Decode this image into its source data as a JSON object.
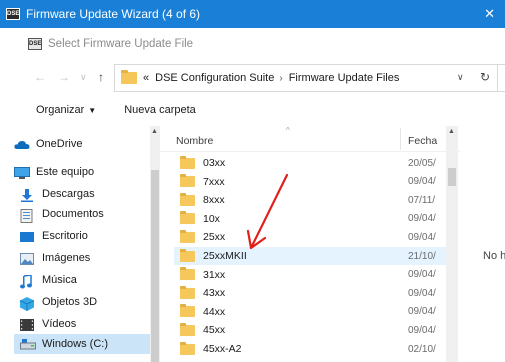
{
  "window": {
    "app_icon_text": "DSE",
    "title": "Firmware Update Wizard (4 of 6)",
    "close_glyph": "✕"
  },
  "dialog": {
    "app_icon_text": "DSE",
    "title": "Select Firmware Update File"
  },
  "address": {
    "back_glyph": "←",
    "forward_glyph": "→",
    "recent_glyph": "∨",
    "up_glyph": "↑",
    "overflow": "«",
    "crumbs": [
      "DSE Configuration Suite",
      "Firmware Update Files"
    ],
    "separator": "›",
    "dropdown_glyph": "∨",
    "refresh_glyph": "↻"
  },
  "toolbar": {
    "organize_label": "Organizar",
    "organize_caret": "▼",
    "new_folder_label": "Nueva carpeta"
  },
  "nav": {
    "items": [
      {
        "label": "OneDrive",
        "icon": "cloud-icon"
      },
      {
        "label": "Este equipo",
        "icon": "computer-icon"
      },
      {
        "label": "Descargas",
        "icon": "download-icon"
      },
      {
        "label": "Documentos",
        "icon": "document-icon"
      },
      {
        "label": "Escritorio",
        "icon": "desktop-icon"
      },
      {
        "label": "Imágenes",
        "icon": "pictures-icon"
      },
      {
        "label": "Música",
        "icon": "music-icon"
      },
      {
        "label": "Objetos 3D",
        "icon": "objects3d-icon"
      },
      {
        "label": "Vídeos",
        "icon": "videos-icon"
      },
      {
        "label": "Windows (C:)",
        "icon": "drive-icon"
      }
    ],
    "scroll_up_glyph": "▲"
  },
  "list": {
    "columns": {
      "name": "Nombre",
      "date": "Fecha",
      "sort_glyph": "^"
    },
    "rows": [
      {
        "name": "03xx",
        "date": "20/05/"
      },
      {
        "name": "7xxx",
        "date": "09/04/"
      },
      {
        "name": "8xxx",
        "date": "07/11/"
      },
      {
        "name": "10x",
        "date": "09/04/"
      },
      {
        "name": "25xx",
        "date": "09/04/"
      },
      {
        "name": "25xxMKII",
        "date": "21/10/"
      },
      {
        "name": "31xx",
        "date": "09/04/"
      },
      {
        "name": "43xx",
        "date": "09/04/"
      },
      {
        "name": "44xx",
        "date": "09/04/"
      },
      {
        "name": "45xx",
        "date": "09/04/"
      },
      {
        "name": "45xx-A2",
        "date": "02/10/"
      }
    ],
    "hover_index": 5,
    "scroll_up_glyph": "▲"
  },
  "preview": {
    "text": "No h"
  },
  "colors": {
    "titlebar": "#1a7fd6",
    "hover_row": "#e5f3ff",
    "selected_nav": "#cce4f7",
    "folder": "#f6c75a",
    "annotation_arrow": "#e0201b"
  }
}
